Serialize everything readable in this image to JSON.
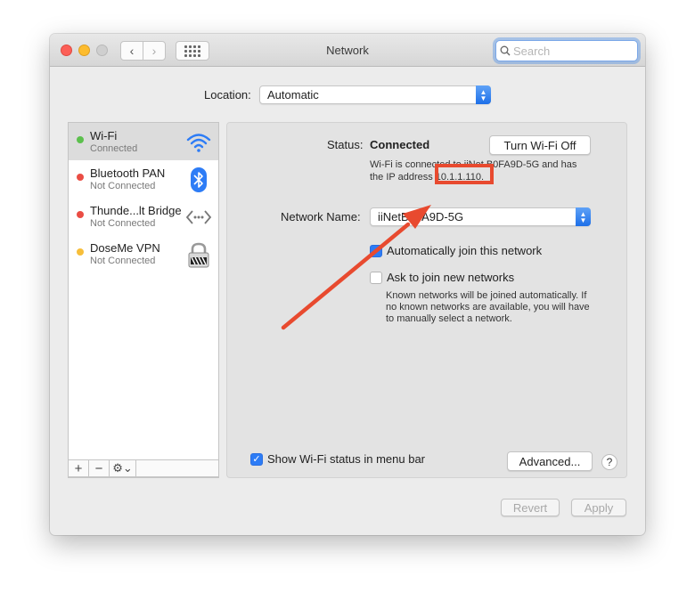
{
  "window": {
    "title": "Network"
  },
  "search": {
    "placeholder": "Search"
  },
  "location": {
    "label": "Location:",
    "value": "Automatic"
  },
  "services": [
    {
      "name": "Wi-Fi",
      "status": "Connected",
      "dot": "#5cc04d",
      "icon": "wifi-icon"
    },
    {
      "name": "Bluetooth PAN",
      "status": "Not Connected",
      "dot": "#ea4d44",
      "icon": "bluetooth-icon"
    },
    {
      "name": "Thunde...lt Bridge",
      "status": "Not Connected",
      "dot": "#ea4d44",
      "icon": "thunderbolt-bridge-icon"
    },
    {
      "name": "DoseMe VPN",
      "status": "Not Connected",
      "dot": "#f7be3a",
      "icon": "vpn-lock-icon"
    }
  ],
  "sidebar_tools": {
    "add": "+",
    "remove": "−",
    "gear": "⚙⌄"
  },
  "panel": {
    "status_label": "Status:",
    "status_value": "Connected",
    "turn_off_button": "Turn Wi-Fi Off",
    "status_desc_line1": "Wi-Fi is connected to iiNet B0FA9D-5G and has",
    "status_desc_line2_prefix": "the IP address ",
    "ip_address": "10.1.1.110.",
    "network_name_label": "Network Name:",
    "network_name_value": "iiNetB0FA9D-5G",
    "auto_join_label": "Automatically join this network",
    "ask_join_label": "Ask to join new networks",
    "ask_join_note": "Known networks will be joined automatically. If no known networks are available, you will have to manually select a network.",
    "show_status_label": "Show Wi-Fi status in menu bar",
    "advanced_button": "Advanced...",
    "help_button": "?"
  },
  "footer": {
    "revert_button": "Revert",
    "apply_button": "Apply"
  },
  "colors": {
    "accent": "#2d7cf6",
    "annotation": "#e84a2f"
  }
}
